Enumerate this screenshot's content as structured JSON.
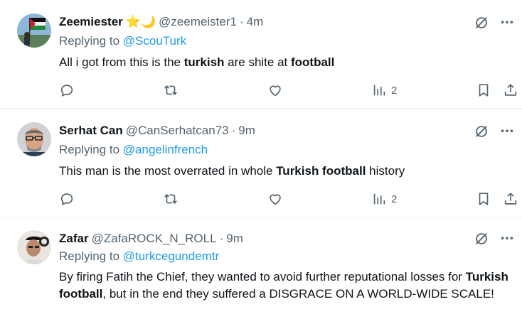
{
  "tweets": [
    {
      "display_name": "Zeemiester",
      "badge": "⭐🌙",
      "handle": "@zeemeister1",
      "dot": "·",
      "time": "4m",
      "replying_prefix": "Replying to ",
      "replying_to": "@ScouTurk",
      "body": [
        "All i got from this is the ",
        "turkish",
        " are shite at ",
        "football"
      ],
      "views": "2"
    },
    {
      "display_name": "Serhat Can",
      "handle": "@CanSerhatcan73",
      "dot": "·",
      "time": "9m",
      "replying_prefix": "Replying to ",
      "replying_to": "@angelinfrench",
      "body": [
        "This man is the most overrated in whole ",
        "Turkish football",
        " history"
      ],
      "views": "2"
    },
    {
      "display_name": "Zafar",
      "handle": "@ZafaROCK_N_ROLL",
      "dot": "·",
      "time": "9m",
      "replying_prefix": "Replying to ",
      "replying_to": "@turkcegundemtr",
      "body": [
        "By firing Fatih the Chief, they wanted to avoid further reputational losses for ",
        "Turkish football",
        ", but in the end they suffered a DISGRACE ON A WORLD-WIDE SCALE!"
      ]
    }
  ],
  "colors": {
    "text": "#0f1419",
    "secondary": "#536471",
    "link": "#1d9bf0",
    "divider": "#eff3f4"
  },
  "icons": [
    "reply-icon",
    "retweet-icon",
    "like-icon",
    "views-icon",
    "bookmark-icon",
    "share-icon",
    "grok-icon",
    "more-icon"
  ]
}
